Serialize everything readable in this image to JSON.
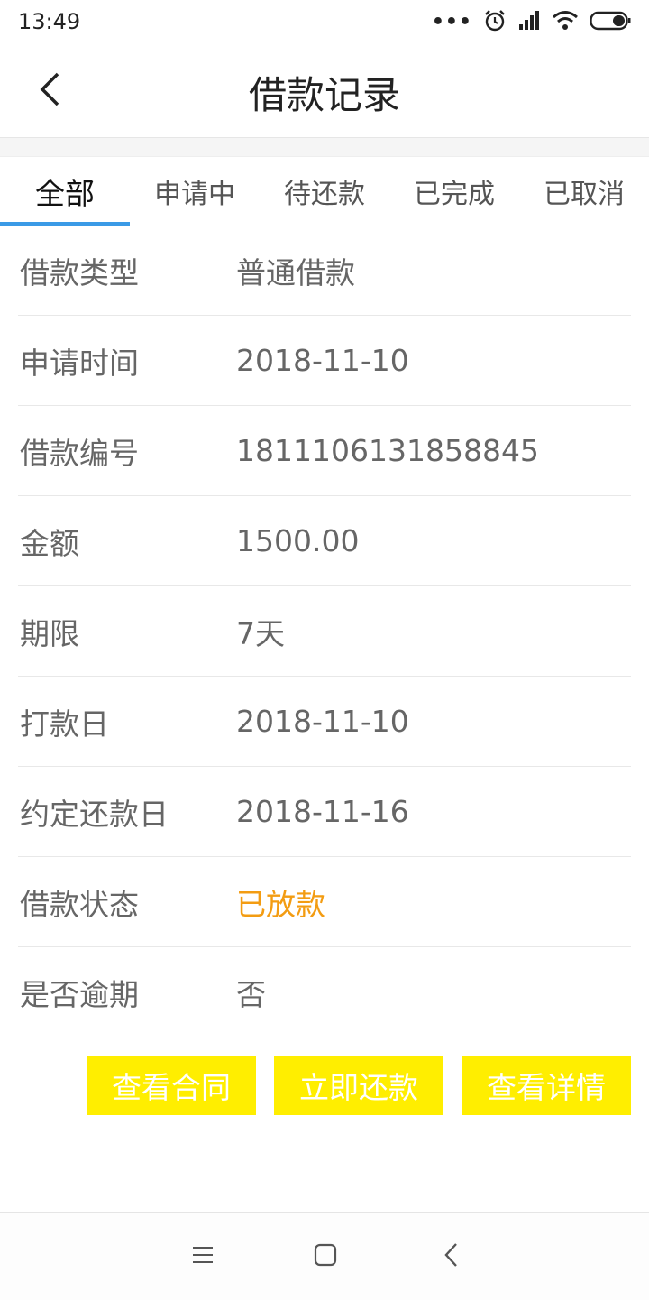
{
  "status_bar": {
    "time": "13:49",
    "dots": "•••"
  },
  "header": {
    "title": "借款记录"
  },
  "tabs": [
    {
      "label": "全部",
      "active": true
    },
    {
      "label": "申请中"
    },
    {
      "label": "待还款"
    },
    {
      "label": "已完成"
    },
    {
      "label": "已取消"
    }
  ],
  "record": {
    "fields": [
      {
        "label": "借款类型",
        "value": "普通借款"
      },
      {
        "label": "申请时间",
        "value": "2018-11-10"
      },
      {
        "label": "借款编号",
        "value": "1811106131858845"
      },
      {
        "label": "金额",
        "value": "1500.00"
      },
      {
        "label": "期限",
        "value": "7天"
      },
      {
        "label": "打款日",
        "value": "2018-11-10"
      },
      {
        "label": "约定还款日",
        "value": "2018-11-16"
      },
      {
        "label": "借款状态",
        "value": "已放款"
      },
      {
        "label": "是否逾期",
        "value": "否"
      }
    ],
    "status_color": "#f39c12"
  },
  "actions": {
    "view_contract": "查看合同",
    "repay_now": "立即还款",
    "view_details": "查看详情"
  },
  "colors": {
    "tab_underline": "#3a9ae6",
    "button_bg": "#ffee00"
  },
  "icons": {
    "back": "chevron-left-icon",
    "menu": "menu-icon",
    "home": "home-square-icon",
    "nav_back": "nav-back-icon"
  }
}
